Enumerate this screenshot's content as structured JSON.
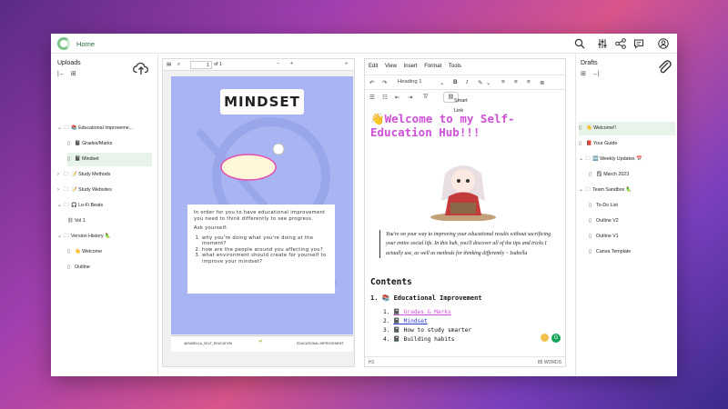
{
  "topbar": {
    "home_label": "Home",
    "icons": [
      "search-icon",
      "sliders-icon",
      "share-icon",
      "chat-icon",
      "user-icon"
    ]
  },
  "uploads": {
    "title": "Uploads",
    "tree": [
      {
        "label": "📚 Educational Improveme...",
        "type": "folder",
        "open": true
      },
      {
        "label": "📓 Grades/Marks",
        "type": "doc"
      },
      {
        "label": "📓 Mindset",
        "type": "doc",
        "selected": true
      },
      {
        "label": "📝 Study Methods",
        "type": "folder"
      },
      {
        "label": "📝 Study Websites",
        "type": "folder"
      },
      {
        "label": "🎧 Lo-Fi Beats",
        "type": "folder",
        "open": true
      },
      {
        "label": "Vol 1",
        "type": "link"
      },
      {
        "label": "Version History 🦜",
        "type": "folder",
        "open": true
      },
      {
        "label": "👋 Welcome",
        "type": "doc"
      },
      {
        "label": "Outline",
        "type": "doc"
      }
    ]
  },
  "pdf": {
    "page": "1",
    "of_label": "of 1",
    "title": "MINDSET",
    "quote_intro": "In order for you to have educational improvement you need to think differently to see progress.",
    "ask": "Ask yourself:",
    "questions": [
      "why you're doing what you're doing at the moment?",
      "how are the people around you affecting you?",
      "what environment should create for yourself to improve your mindset?"
    ],
    "footer_left": "@ISABELLA_SELF_EDUCATION",
    "footer_right": "EDUCATIONAL IMPROVEMENT"
  },
  "editor": {
    "menu": [
      "Edit",
      "View",
      "Insert",
      "Format",
      "Tools"
    ],
    "style_select": "Heading 1",
    "smart_link": "Smart Link",
    "heading": "👋Welcome to my Self-Education Hub!!!",
    "quote": "You're on your way to improving your educational results without sacrificing your entire social life. In this hub, you'll discover all of the tips and tricks I actually use, as well as methods for thinking differently ~ Isabella",
    "contents_title": "Contents",
    "list_title": "1. 📚 Educational Improvement",
    "sub_items": [
      {
        "num": "1.",
        "label": "📓 Grades & Marks",
        "link": true
      },
      {
        "num": "2.",
        "label": "📓 Mindset",
        "link": true
      },
      {
        "num": "3.",
        "label": "📓 How to study smarter",
        "link": false
      },
      {
        "num": "4.",
        "label": "📓 Building habits",
        "link": false
      }
    ],
    "status_left": "H1",
    "status_right": "85 WORDS"
  },
  "drafts": {
    "title": "Drafts",
    "tree": [
      {
        "label": "👋 Welcome!!",
        "type": "doc",
        "selected": true
      },
      {
        "label": "📕 Your Guide",
        "type": "doc"
      },
      {
        "label": "🆕 Weekly Updates 📅",
        "type": "folder",
        "open": true
      },
      {
        "label": "🗒 March 2023",
        "type": "doc"
      },
      {
        "label": "Team Sandbox 🦜",
        "type": "folder",
        "open": true
      },
      {
        "label": "To-Do List",
        "type": "doc"
      },
      {
        "label": "Outline V2",
        "type": "doc"
      },
      {
        "label": "Outline V1",
        "type": "doc"
      },
      {
        "label": "Canva Template",
        "type": "doc"
      }
    ]
  },
  "colors": {
    "accent_green": "#7fc48a",
    "heading_pink": "#cf4fd8",
    "selected_bg": "#e8f3e9"
  }
}
